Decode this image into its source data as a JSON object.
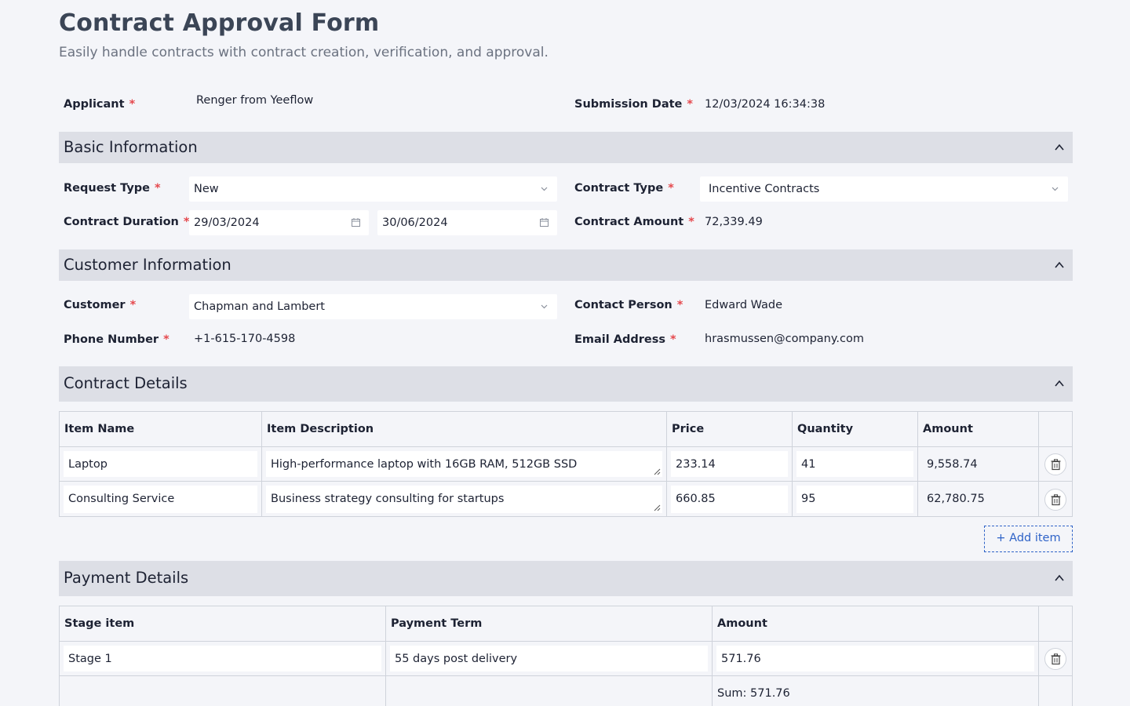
{
  "header": {
    "title": "Contract Approval Form",
    "subtitle": "Easily handle contracts with contract creation, verification, and approval."
  },
  "top": {
    "applicant_label": "Applicant",
    "applicant_value": "Renger from Yeeflow",
    "submission_date_label": "Submission Date",
    "submission_date_value": "12/03/2024 16:34:38"
  },
  "basic": {
    "title": "Basic Information",
    "request_type_label": "Request Type",
    "request_type_value": "New",
    "contract_type_label": "Contract Type",
    "contract_type_value": "Incentive Contracts",
    "duration_label": "Contract Duration",
    "duration_start": "29/03/2024",
    "duration_end": "30/06/2024",
    "amount_label": "Contract Amount",
    "amount_value": "72,339.49"
  },
  "customer": {
    "title": "Customer Information",
    "customer_label": "Customer",
    "customer_value": "Chapman and Lambert",
    "contact_label": "Contact Person",
    "contact_value": "Edward Wade",
    "phone_label": "Phone Number",
    "phone_value": "+1-615-170-4598",
    "email_label": "Email Address",
    "email_value": "hrasmussen@company.com"
  },
  "contract_details": {
    "title": "Contract Details",
    "columns": [
      "Item Name",
      "Item Description",
      "Price",
      "Quantity",
      "Amount"
    ],
    "rows": [
      {
        "name": "Laptop",
        "description": "High-performance laptop with 16GB RAM, 512GB SSD",
        "price": "233.14",
        "quantity": "41",
        "amount": "9,558.74"
      },
      {
        "name": "Consulting Service",
        "description": "Business strategy consulting for startups",
        "price": "660.85",
        "quantity": "95",
        "amount": "62,780.75"
      }
    ],
    "add_label": "+ Add item"
  },
  "payment": {
    "title": "Payment Details",
    "columns": [
      "Stage item",
      "Payment Term",
      "Amount"
    ],
    "rows": [
      {
        "stage": "Stage 1",
        "term": "55 days post delivery",
        "amount": "571.76"
      }
    ],
    "sum": "Sum: 571.76"
  },
  "icons": {
    "collapse": "chevron-up-icon",
    "dropdown": "chevron-down-icon",
    "calendar": "calendar-icon",
    "delete": "trash-icon"
  },
  "colors": {
    "required": "#e5484d",
    "accent": "#2f63c8",
    "section_bg": "#dddfe6",
    "page_bg": "#f4f5f9"
  }
}
